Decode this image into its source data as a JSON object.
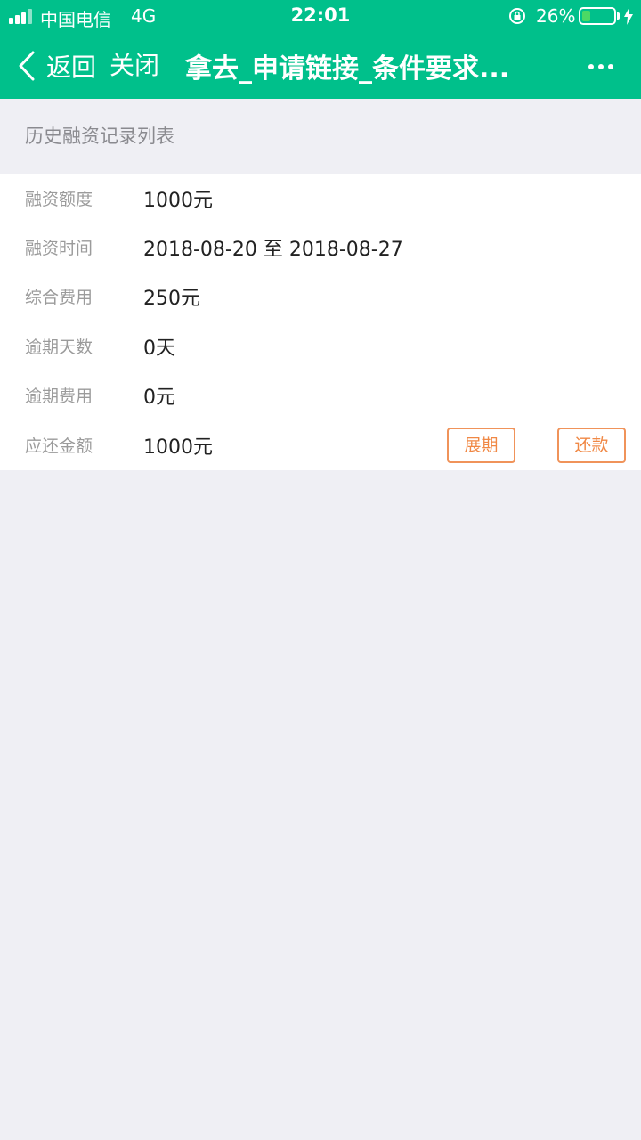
{
  "status_bar": {
    "carrier": "中国电信",
    "network": "4G",
    "time": "22:01",
    "battery_percent": "26%",
    "battery_level": 0.26,
    "icons": [
      "signal-icon",
      "rotation-lock-icon",
      "battery-icon",
      "charging-icon"
    ]
  },
  "nav": {
    "back_label": "返回",
    "close_label": "关闭",
    "title": "拿去_申请链接_条件要求...",
    "icons": [
      "back-chevron-icon",
      "more-icon"
    ]
  },
  "section_title": "历史融资记录列表",
  "record": {
    "rows": [
      {
        "label": "融资额度",
        "value": "1000元"
      },
      {
        "label": "融资时间",
        "value": "2018-08-20 至 2018-08-27"
      },
      {
        "label": "综合费用",
        "value": "250元"
      },
      {
        "label": "逾期天数",
        "value": "0天"
      },
      {
        "label": "逾期费用",
        "value": "0元"
      },
      {
        "label": "应还金额",
        "value": "1000元"
      }
    ],
    "extend_label": "展期",
    "repay_label": "还款"
  },
  "colors": {
    "brand": "#00c08b",
    "background": "#efeff4",
    "accent_button": "#f08845"
  }
}
